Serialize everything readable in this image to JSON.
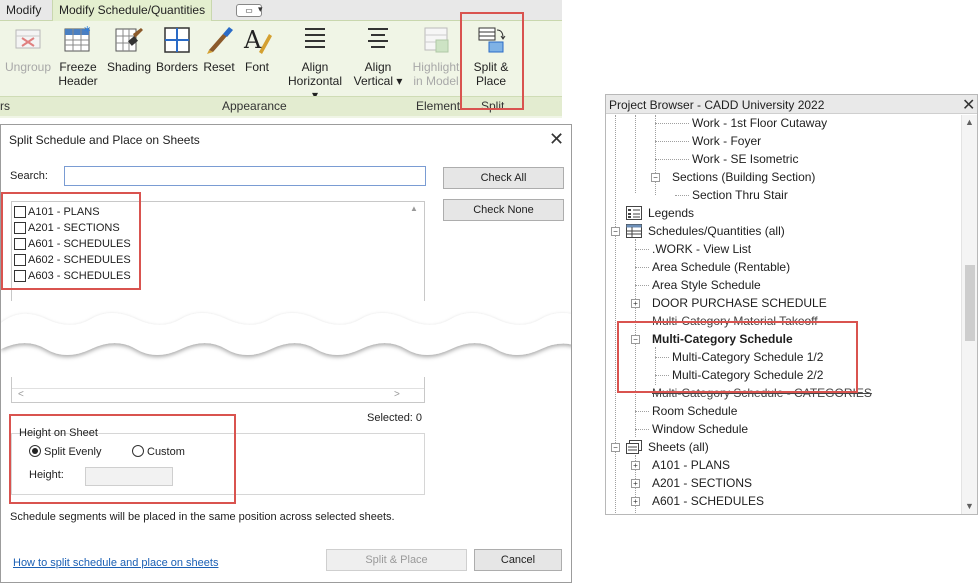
{
  "ribbon": {
    "tabs": [
      "Modify",
      "Modify Schedule/Quantities"
    ],
    "buttons": [
      {
        "label": "Ungroup",
        "icon": "ungroup-icon",
        "enabled": false
      },
      {
        "label": "Freeze Header",
        "icon": "freeze-header-icon",
        "enabled": true
      },
      {
        "label": "Shading",
        "icon": "shading-icon",
        "enabled": true
      },
      {
        "label": "Borders",
        "icon": "borders-icon",
        "enabled": true
      },
      {
        "label": "Reset",
        "icon": "reset-icon",
        "enabled": true
      },
      {
        "label": "Font",
        "icon": "font-icon",
        "enabled": true
      },
      {
        "label": "Align Horizontal",
        "icon": "align-horizontal-icon",
        "enabled": true
      },
      {
        "label": "Align Vertical",
        "icon": "align-vertical-icon",
        "enabled": true
      },
      {
        "label": "Highlight in Model",
        "icon": "highlight-in-model-icon",
        "enabled": false
      },
      {
        "label": "Split & Place",
        "icon": "split-place-icon",
        "enabled": true
      }
    ],
    "panels": [
      "rs",
      "Appearance",
      "Element",
      "Split"
    ]
  },
  "dialog": {
    "title": "Split Schedule and Place on Sheets",
    "search_label": "Search:",
    "search_value": "",
    "check_all": "Check All",
    "check_none": "Check None",
    "sheets": [
      {
        "label": "A101 - PLANS",
        "checked": false
      },
      {
        "label": "A201 - SECTIONS",
        "checked": false
      },
      {
        "label": "A601 - SCHEDULES",
        "checked": false
      },
      {
        "label": "A602 - SCHEDULES",
        "checked": false
      },
      {
        "label": "A603 - SCHEDULES",
        "checked": false
      }
    ],
    "selected_text": "Selected: 0",
    "height_group_label": "Height on Sheet",
    "split_evenly": "Split Evenly",
    "custom": "Custom",
    "height_label": "Height:",
    "height_value": "",
    "placement_note": "Schedule segments will be placed in the same position across selected sheets.",
    "help_link": "How to split schedule and place on sheets",
    "split_place_button": "Split & Place",
    "cancel_button": "Cancel"
  },
  "browser": {
    "title": "Project Browser - CADD University 2022",
    "items": [
      {
        "label": "Work - 1st Floor Cutaway"
      },
      {
        "label": "Work - Foyer"
      },
      {
        "label": "Work - SE Isometric"
      },
      {
        "label": "Sections (Building Section)"
      },
      {
        "label": "Section Thru Stair"
      },
      {
        "label": "Legends"
      },
      {
        "label": "Schedules/Quantities (all)"
      },
      {
        "label": ".WORK - View List"
      },
      {
        "label": "Area Schedule (Rentable)"
      },
      {
        "label": "Area Style Schedule"
      },
      {
        "label": "DOOR PURCHASE SCHEDULE"
      },
      {
        "label": "Multi-Category Material Takeoff"
      },
      {
        "label": "Multi-Category Schedule"
      },
      {
        "label": "Multi-Category Schedule 1/2"
      },
      {
        "label": "Multi-Category Schedule 2/2"
      },
      {
        "label": "Multi-Category Schedule - CATEGORIES"
      },
      {
        "label": "Room Schedule"
      },
      {
        "label": "Window Schedule"
      },
      {
        "label": "Sheets (all)"
      },
      {
        "label": "A101 - PLANS"
      },
      {
        "label": "A201 - SECTIONS"
      },
      {
        "label": "A601 - SCHEDULES"
      }
    ]
  },
  "colors": {
    "ribbon_bg": "#f0f5e6",
    "highlight_box": "#d9534f",
    "link": "#1a5fb4"
  }
}
